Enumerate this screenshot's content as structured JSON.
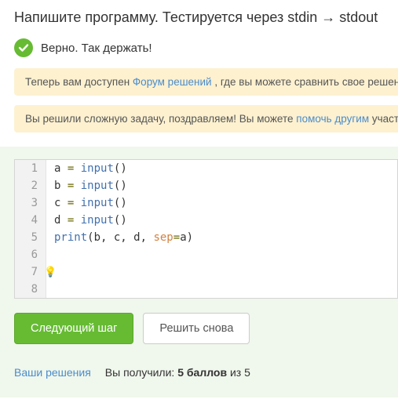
{
  "title": "Напишите программу. Тестируется через stdin → stdout",
  "status": {
    "icon": "check-icon",
    "text": "Верно. Так держать!"
  },
  "alerts": [
    {
      "before": "Теперь вам доступен ",
      "link": "Форум решений",
      "after": " , где вы можете сравнить свое решение"
    },
    {
      "before": "Вы решили сложную задачу, поздравляем! Вы можете ",
      "link": "помочь другим",
      "after": " участникам"
    }
  ],
  "code": {
    "lines": [
      {
        "n": "1",
        "var": "a",
        "rhs": "input",
        "args": ""
      },
      {
        "n": "2",
        "var": "b",
        "rhs": "input",
        "args": ""
      },
      {
        "n": "3",
        "var": "c",
        "rhs": "input",
        "args": ""
      },
      {
        "n": "4",
        "var": "d",
        "rhs": "input",
        "args": ""
      },
      {
        "n": "5",
        "print": true,
        "fn": "print",
        "args_plain": "b, c, d, ",
        "kw": "sep",
        "kwop": "=",
        "kwval": "a"
      },
      {
        "n": "6",
        "blank": true
      },
      {
        "n": "7",
        "blank": true,
        "bulb": true
      },
      {
        "n": "8",
        "blank": true
      }
    ],
    "eq": " = ",
    "lpar": "(",
    "rpar": ")"
  },
  "buttons": {
    "next": "Следующий шаг",
    "retry": "Решить снова"
  },
  "footer": {
    "solutions_link": "Ваши решения",
    "score_prefix": "Вы получили: ",
    "score_value": "5 баллов",
    "score_suffix": " из 5"
  }
}
